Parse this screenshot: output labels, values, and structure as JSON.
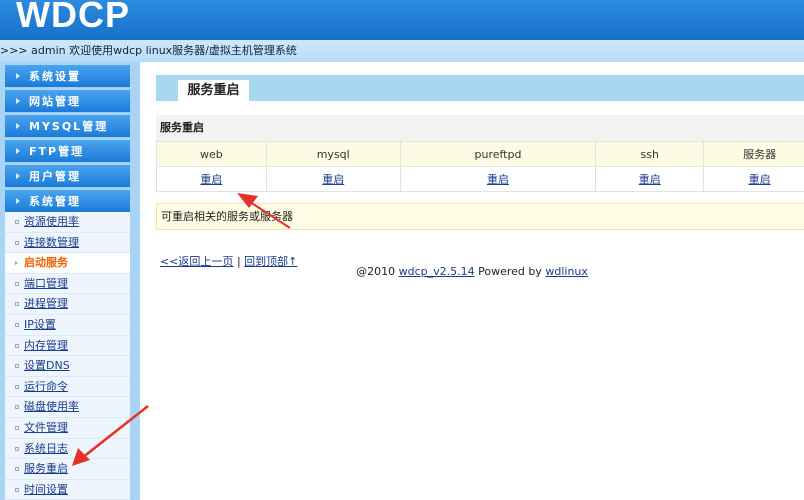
{
  "header": {
    "logo": "WDCP",
    "breadcrumb": ">>> admin 欢迎使用wdcp linux服务器/虚拟主机管理系统"
  },
  "sidebar": {
    "menus": [
      "系统设置",
      "网站管理",
      "MYSQL管理",
      "FTP管理",
      "用户管理",
      "系统管理"
    ],
    "sub_items": [
      "资源使用率",
      "连接数管理",
      "启动服务",
      "端口管理",
      "进程管理",
      "IP设置",
      "内存管理",
      "设置DNS",
      "运行命令",
      "磁盘使用率",
      "文件管理",
      "系统日志",
      "服务重启",
      "时间设置"
    ],
    "active_index": 2
  },
  "main": {
    "tab": "服务重启",
    "section_title": "服务重启",
    "table": {
      "headers": [
        "web",
        "mysql",
        "pureftpd",
        "ssh",
        "服务器"
      ],
      "actions": [
        "重启",
        "重启",
        "重启",
        "重启",
        "重启"
      ]
    },
    "note": "可重启相关的服务或服务器",
    "back_link": "<<返回上一页",
    "sep": "|",
    "top_link": "回到顶部↑",
    "footer": {
      "prefix": "@2010 ",
      "version": "wdcp_v2.5.14",
      "mid": " Powered by ",
      "brand": "wdlinux"
    }
  },
  "colors": {
    "header": "#1670c9",
    "accent_active": "#f06000",
    "arrow": "#e8302a"
  }
}
